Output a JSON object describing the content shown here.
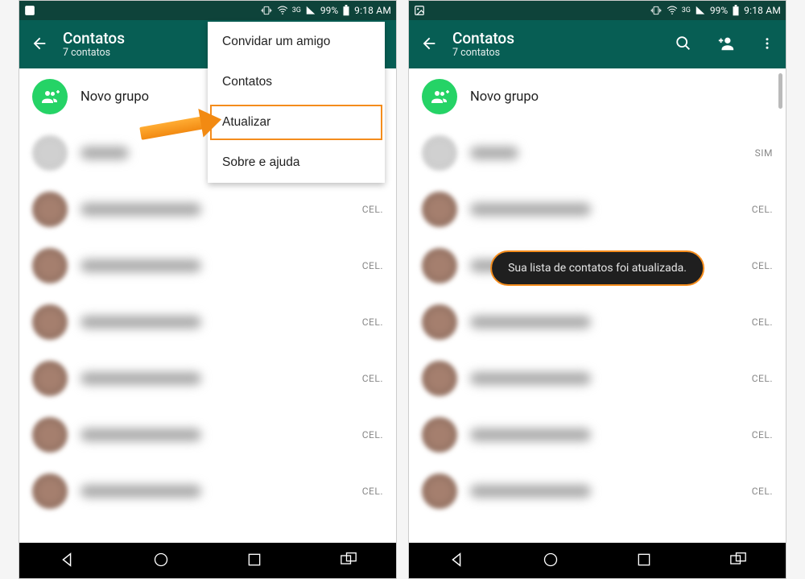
{
  "status": {
    "battery_pct": "99%",
    "time": "9:18 AM",
    "network": "3G"
  },
  "appbar": {
    "title": "Contatos",
    "subtitle": "7 contatos"
  },
  "new_group": "Novo grupo",
  "menu": {
    "invite": "Convidar um amigo",
    "contacts": "Contatos",
    "refresh": "Atualizar",
    "about": "Sobre e ajuda"
  },
  "tags": {
    "sim": "SIM",
    "cel": "CEL."
  },
  "toast": "Sua lista de contatos foi atualizada."
}
